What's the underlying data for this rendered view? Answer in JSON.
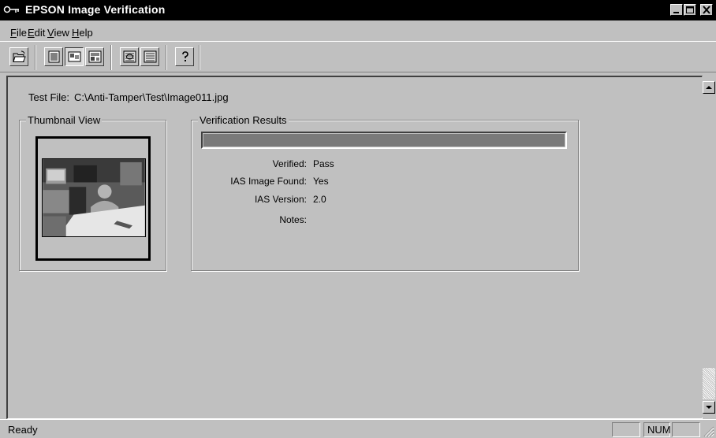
{
  "window": {
    "title": "EPSON Image Verification"
  },
  "menu": [
    {
      "label": "File",
      "underline": "F",
      "rest": "ile"
    },
    {
      "label": "Edit",
      "underline": "E",
      "rest": "dit"
    },
    {
      "label": "View",
      "underline": "V",
      "rest": "iew"
    },
    {
      "label": "Help",
      "underline": "H",
      "rest": "elp"
    }
  ],
  "toolbar": {
    "buttons": [
      {
        "name": "open-icon"
      },
      {
        "name": "details-view-icon"
      },
      {
        "name": "thumbnail-view-icon",
        "pressed": true
      },
      {
        "name": "large-icon-view-icon"
      },
      {
        "name": "verify-icon"
      },
      {
        "name": "verify-all-icon"
      },
      {
        "name": "help-icon"
      }
    ]
  },
  "testfile": {
    "label": "Test File:",
    "value": "C:\\Anti-Tamper\\Test\\Image011.jpg"
  },
  "thumbnail": {
    "title": "Thumbnail View"
  },
  "verification": {
    "title": "Verification Results",
    "progress": 1.0,
    "rows": [
      {
        "key": "Verified:",
        "value": "Pass"
      },
      {
        "key": "IAS Image Found:",
        "value": "Yes"
      },
      {
        "key": "IAS Version:",
        "value": "2.0"
      },
      {
        "key": "Notes:",
        "value": ""
      }
    ]
  },
  "status": {
    "text": "Ready",
    "num": "NUM"
  }
}
